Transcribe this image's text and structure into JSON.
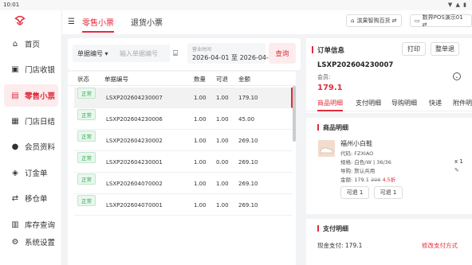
{
  "status_bar": {
    "time": "10:01",
    "icons": "▼ ▲ ▮"
  },
  "sidebar": {
    "items": [
      {
        "label": "首页",
        "icon": "home-icon",
        "glyph": "⌂"
      },
      {
        "label": "门店收银",
        "icon": "cashier-icon",
        "glyph": "▣"
      },
      {
        "label": "零售小票",
        "icon": "receipt-icon",
        "glyph": "▤",
        "active": true
      },
      {
        "label": "门店日结",
        "icon": "calendar-icon",
        "glyph": "▦"
      },
      {
        "label": "会员资料",
        "icon": "member-icon",
        "glyph": "●"
      },
      {
        "label": "订金单",
        "icon": "deposit-icon",
        "glyph": "◈"
      },
      {
        "label": "移仓单",
        "icon": "transfer-icon",
        "glyph": "⇄"
      },
      {
        "label": "库存查询",
        "icon": "inventory-icon",
        "glyph": "▥"
      },
      {
        "label": "系统设置",
        "icon": "settings-icon",
        "glyph": "⚙"
      }
    ]
  },
  "header": {
    "menu_glyph": "☰",
    "tabs": [
      {
        "label": "零售小票",
        "active": true
      },
      {
        "label": "退货小票",
        "active": false
      }
    ],
    "store": "滨果智购百货 ⇄",
    "pos": "数界POS演示01 ⇄"
  },
  "filter": {
    "select_label": "单据编号 ▾",
    "input_placeholder": "输入单据编号",
    "scan_glyph": "⌸",
    "date_label": "营业时间",
    "date_value": "2026-04-01  至  2026-04-",
    "query_label": "查询"
  },
  "table": {
    "columns": [
      "状态",
      "单据编号",
      "数量",
      "可退",
      "金额"
    ],
    "rows": [
      [
        "正常",
        "LSXP202604230007",
        "1.00",
        "1.00",
        "179.10"
      ],
      [
        "正常",
        "LSXP202604230006",
        "1.00",
        "1.00",
        "45.00"
      ],
      [
        "正常",
        "LSXP202604230002",
        "1.00",
        "1.00",
        "269.10"
      ],
      [
        "正常",
        "LSXP202604230001",
        "1.00",
        "0.00",
        "269.10"
      ],
      [
        "正常",
        "LSXP202604070002",
        "1.00",
        "1.00",
        "269.10"
      ],
      [
        "正常",
        "LSXP202604070001",
        "1.00",
        "1.00",
        "269.10"
      ]
    ]
  },
  "order": {
    "title": "订单信息",
    "print_label": "打印",
    "return_all_label": "整单退",
    "order_no": "LSXP202604230007",
    "member_label": "会员:",
    "total": "179.1",
    "sub_tabs": [
      "商品明细",
      "支付明细",
      "导购明细",
      "快递",
      "附件明"
    ],
    "product_section": "商品明细",
    "product": {
      "name": "福州小白鞋",
      "code": "代码: FZXIAO",
      "spec": "规格: 白色/W | 36/36",
      "guide": "导购: 默认兵用",
      "amount_prefix": "金额: 179.1",
      "orig_price": "398",
      "discount": "4.5折",
      "qty": "x 1",
      "edit_glyph": "✎",
      "btn_return": "可退 1",
      "btn_returned": "可退 1"
    },
    "payment_section": "支付明细",
    "payment_line": "现金支付: 179.1",
    "edit_payment_label": "修改支付方式"
  },
  "colors": {
    "accent": "#e02b3c",
    "accent_bg": "#fdeced",
    "ok_green": "#2ba84a"
  }
}
